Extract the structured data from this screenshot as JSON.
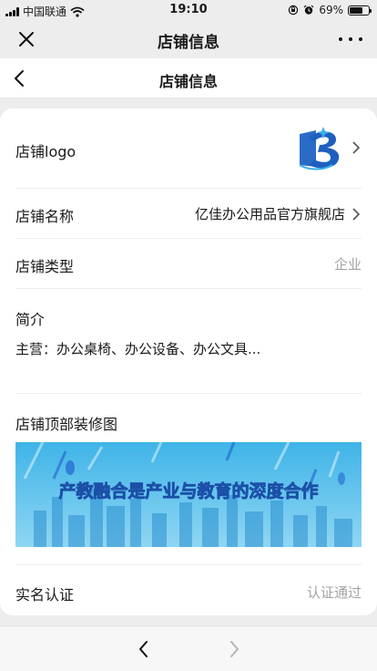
{
  "status_bar": {
    "carrier": "中国联通",
    "time": "19:10",
    "battery_percent": "69%",
    "battery_level": 0.69
  },
  "wechat_nav": {
    "title": "店铺信息"
  },
  "page_nav": {
    "title": "店铺信息"
  },
  "shop": {
    "logo_label": "店铺logo",
    "name_label": "店铺名称",
    "name_value": "亿佳办公用品官方旗舰店",
    "type_label": "店铺类型",
    "type_value": "企业",
    "intro_label": "简介",
    "intro_text": "主营：办公桌椅、办公设备、办公文具...",
    "banner_label": "店铺顶部装修图",
    "banner_text": "产教融合是产业与教育的深度合作",
    "verify_label": "实名认证",
    "verify_value": "认证通过"
  },
  "colors": {
    "accent_blue": "#1f5fbf",
    "banner_sky": "#3fb4e8",
    "muted_text": "#a3a3a3"
  },
  "icons": {
    "close": "close-icon",
    "more": "more-icon",
    "back": "back-chevron-icon",
    "forward": "forward-chevron-icon",
    "row_arrow": "chevron-right-icon",
    "wifi": "wifi-icon",
    "lock_rotation": "orientation-lock-icon",
    "alarm": "alarm-icon",
    "battery": "battery-icon"
  }
}
